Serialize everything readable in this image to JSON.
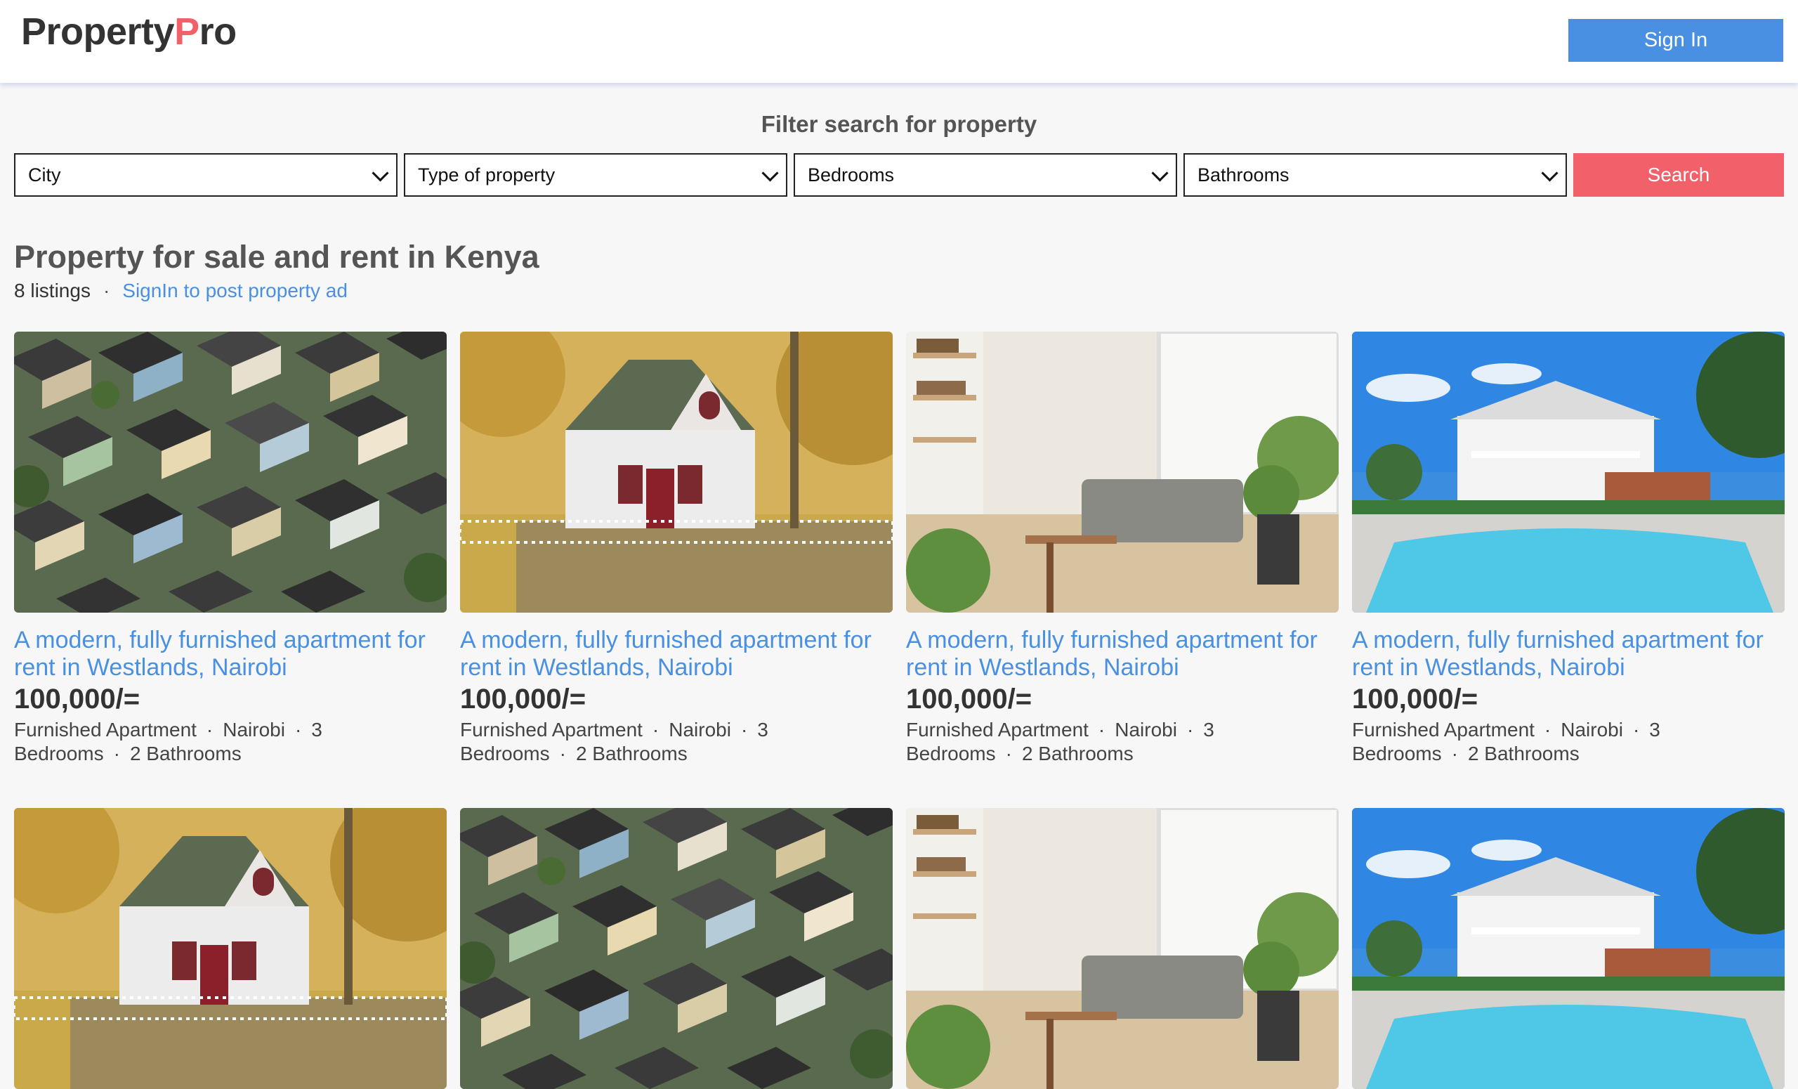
{
  "header": {
    "logo_part1": "Property",
    "logo_part2": "P",
    "logo_part3": "ro",
    "signin_label": "Sign In"
  },
  "filter": {
    "title": "Filter search for property",
    "city": "City",
    "type": "Type of property",
    "bedrooms": "Bedrooms",
    "bathrooms": "Bathrooms",
    "search_label": "Search"
  },
  "listing_header": {
    "title": "Property for sale and rent in Kenya",
    "count": "8 listings",
    "dot": "·",
    "signin_link": "SignIn to post property ad"
  },
  "listings": [
    {
      "title": "A modern, fully furnished apartment for rent in Westlands, Nairobi",
      "price": "100,000/=",
      "type": "Furnished Apartment",
      "city": "Nairobi",
      "bedrooms_num": "3",
      "bedrooms_word": "Bedrooms",
      "bathrooms": "2 Bathrooms",
      "image": "aerial-houses"
    },
    {
      "title": "A modern, fully furnished apartment for rent in Westlands, Nairobi",
      "price": "100,000/=",
      "type": "Furnished Apartment",
      "city": "Nairobi",
      "bedrooms_num": "3",
      "bedrooms_word": "Bedrooms",
      "bathrooms": "2 Bathrooms",
      "image": "white-house"
    },
    {
      "title": "A modern, fully furnished apartment for rent in Westlands, Nairobi",
      "price": "100,000/=",
      "type": "Furnished Apartment",
      "city": "Nairobi",
      "bedrooms_num": "3",
      "bedrooms_word": "Bedrooms",
      "bathrooms": "2 Bathrooms",
      "image": "living-room"
    },
    {
      "title": "A modern, fully furnished apartment for rent in Westlands, Nairobi",
      "price": "100,000/=",
      "type": "Furnished Apartment",
      "city": "Nairobi",
      "bedrooms_num": "3",
      "bedrooms_word": "Bedrooms",
      "bathrooms": "2 Bathrooms",
      "image": "pool-villa"
    },
    {
      "image": "white-house"
    },
    {
      "image": "aerial-houses"
    },
    {
      "image": "living-room"
    },
    {
      "image": "pool-villa"
    }
  ],
  "colors": {
    "accent_blue": "#4a90e2",
    "accent_red": "#f2606a"
  }
}
